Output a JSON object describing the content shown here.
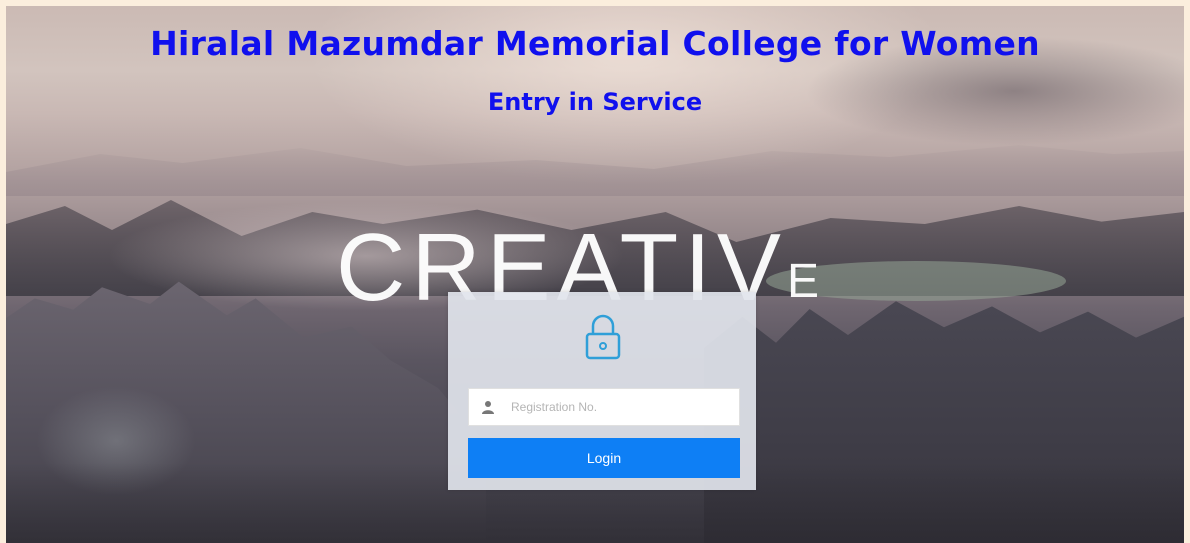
{
  "header": {
    "title": "Hiralal Mazumdar Memorial College for Women",
    "subtitle": "Entry in Service"
  },
  "hero": {
    "word": "CREATIV",
    "word_last": "E"
  },
  "login": {
    "lock_icon": "lock-icon",
    "user_icon": "user-icon",
    "registration_placeholder": "Registration No.",
    "registration_value": "",
    "submit_label": "Login"
  },
  "colors": {
    "title": "#1010ee",
    "button": "#0e7ff5",
    "lock_icon": "#2f9fd8",
    "page_border": "#fbeedd"
  }
}
